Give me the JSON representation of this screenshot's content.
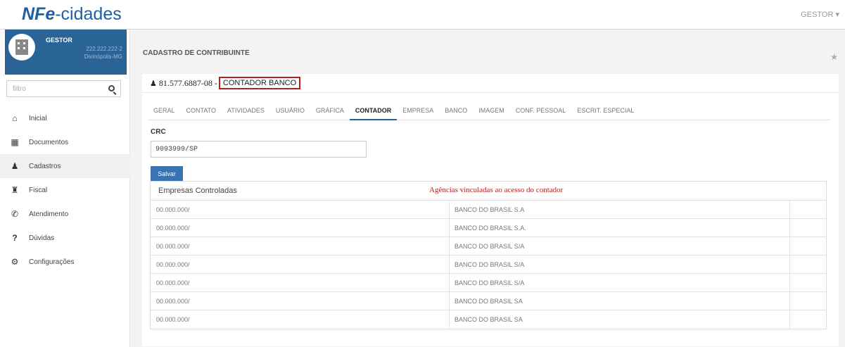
{
  "app": {
    "logo_bold": "NFe",
    "logo_rest": "-cidades",
    "user_menu": "GESTOR ▾"
  },
  "profile": {
    "name": "GESTOR",
    "doc": "222.222.222-2",
    "city": "Divinópolis-MG"
  },
  "sidebar": {
    "filter_placeholder": "filtro",
    "items": [
      {
        "label": "Inicial",
        "icon": "home-icon"
      },
      {
        "label": "Documentos",
        "icon": "documents-icon"
      },
      {
        "label": "Cadastros",
        "icon": "add-user-icon"
      },
      {
        "label": "Fiscal",
        "icon": "bank-icon"
      },
      {
        "label": "Atendimento",
        "icon": "phone-icon"
      },
      {
        "label": "Dúvidas",
        "icon": "question-icon"
      },
      {
        "label": "Configurações",
        "icon": "gears-icon"
      }
    ],
    "active_index": 2
  },
  "page": {
    "header": "CADASTRO DE CONTRIBUINTE",
    "doc_number": "81.577.6887-08 -",
    "contributor_name": "CONTADOR BANCO"
  },
  "tabs": [
    "GERAL",
    "CONTATO",
    "ATIVIDADES",
    "USUÁRIO",
    "GRÁFICA",
    "CONTADOR",
    "EMPRESA",
    "BANCO",
    "IMAGEM",
    "CONF. PESSOAL",
    "ESCRIT. ESPECIAL"
  ],
  "active_tab": "CONTADOR",
  "form": {
    "crc_label": "CRC",
    "crc_value": "9093999/SP",
    "save_label": "Salvar"
  },
  "table": {
    "title": "Empresas Controladas",
    "note": "Agências vinculadas ao acesso do contador",
    "rows": [
      {
        "cnpj": "00.000.000/",
        "bank": "BANCO DO BRASIL S.A"
      },
      {
        "cnpj": "00.000.000/",
        "bank": "BANCO DO BRASIL S.A."
      },
      {
        "cnpj": "00.000.000/",
        "bank": "BANCO DO BRASIL S/A"
      },
      {
        "cnpj": "00.000.000/",
        "bank": "BANCO DO BRASIL S/A"
      },
      {
        "cnpj": "00.000.000/",
        "bank": "BANCO DO BRASIL S/A"
      },
      {
        "cnpj": "00.000.000/",
        "bank": "BANCO DO BRASIL SA"
      },
      {
        "cnpj": "00.000.000/",
        "bank": "BANCO DO BRASIL SA"
      }
    ]
  },
  "colors": {
    "brand": "#1f5fa3",
    "profile_bg": "#2a6496",
    "highlight": "#b22222"
  }
}
